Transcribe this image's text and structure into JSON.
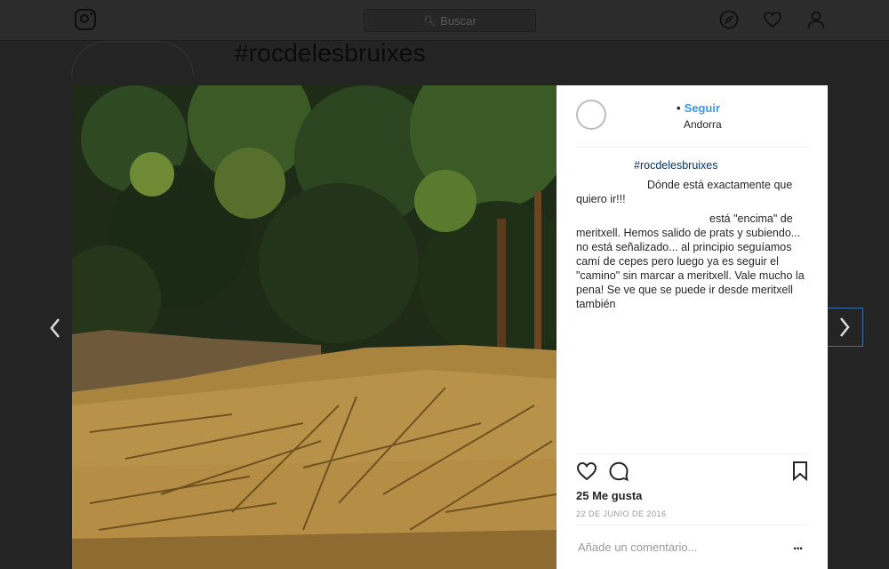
{
  "topbar": {
    "search_placeholder": "Buscar",
    "logo_icon": "instagram-logo-icon",
    "icons": [
      "compass-icon",
      "heart-icon",
      "user-icon"
    ]
  },
  "page": {
    "title": "#rocdelesbruixes"
  },
  "post": {
    "follow_label": "Seguir",
    "location": "Andorra",
    "caption_1_tag": "#rocdelesbruixes",
    "caption_2_text": "Dónde está exactamente que quiero ir!!!",
    "caption_3_text": "está \"encima\" de meritxell. Hemos salido de prats y subiendo... no está señalizado... al principio seguíamos camí de cepes pero luego ya es seguir el \"camino\" sin marcar a meritxell. Vale mucho la pena! Se ve que se puede ir desde meritxell también",
    "likes": "25 Me gusta",
    "date": "22 DE JUNIO DE 2016",
    "comment_placeholder": "Añade un comentario...",
    "more_label": "..."
  },
  "colors": {
    "link": "#3897f0",
    "hashtag": "#003569",
    "text": "#262626",
    "muted": "#999999",
    "overlay": "#242424"
  }
}
